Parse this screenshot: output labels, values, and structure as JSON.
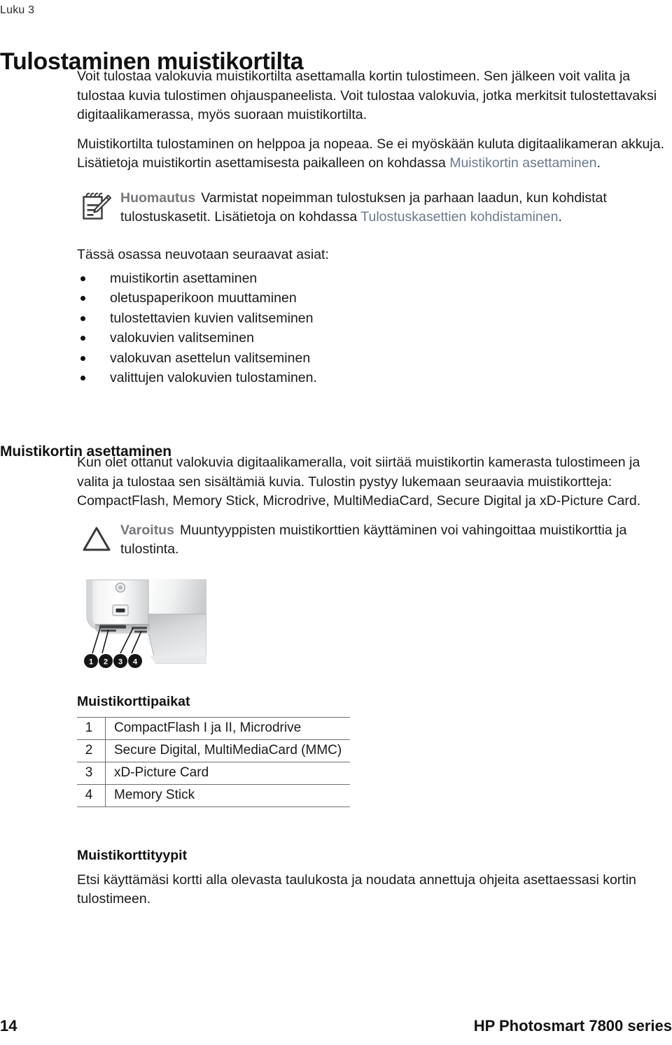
{
  "header": {
    "running_head": "Luku 3"
  },
  "chapter": {
    "title": "Tulostaminen muistikortilta"
  },
  "intro": {
    "para1": "Voit tulostaa valokuvia muistikortilta asettamalla kortin tulostimeen. Sen jälkeen voit valita ja tulostaa kuvia tulostimen ohjauspaneelista. Voit tulostaa valokuvia, jotka merkitsit tulostettavaksi digitaalikamerassa, myös suoraan muistikortilta.",
    "para2_before_link": "Muistikortilta tulostaminen on helppoa ja nopeaa. Se ei myöskään kuluta digitaalikameran akkuja. Lisätietoja muistikortin asettamisesta paikalleen on kohdassa ",
    "para2_link": "Muistikortin asettaminen",
    "para2_after_link": "."
  },
  "note": {
    "icon": "note-pencil-icon",
    "label": "Huomautus",
    "text_before_link": "Varmistat nopeimman tulostuksen ja parhaan laadun, kun kohdistat tulostuskasetit. Lisätietoja on kohdassa ",
    "link": "Tulostuskasettien kohdistaminen",
    "text_after_link": "."
  },
  "toc": {
    "lead": "Tässä osassa neuvotaan seuraavat asiat:",
    "items": [
      "muistikortin asettaminen",
      "oletuspaperikoon muuttaminen",
      "tulostettavien kuvien valitseminen",
      "valokuvien valitseminen",
      "valokuvan asettelun valitseminen",
      "valittujen valokuvien tulostaminen."
    ]
  },
  "section_insert": {
    "heading": "Muistikortin asettaminen",
    "para": "Kun olet ottanut valokuvia digitaalikameralla, voit siirtää muistikortin kamerasta tulostimeen ja valita ja tulostaa sen sisältämiä kuvia. Tulostin pystyy lukemaan seuraavia muistikortteja: CompactFlash, Memory Stick, Microdrive, MultiMediaCard, Secure Digital ja xD-Picture Card."
  },
  "caution": {
    "icon": "warning-triangle-icon",
    "label": "Varoitus",
    "text": "Muuntyyppisten muistikorttien käyttäminen voi vahingoittaa muistikorttia ja tulostinta."
  },
  "figure": {
    "alt_name": "printer-memory-card-slots-illustration",
    "callouts": [
      "1",
      "2",
      "3",
      "4"
    ]
  },
  "slots_table": {
    "caption": "Muistikorttipaikat",
    "rows": [
      {
        "num": "1",
        "desc": "CompactFlash I ja II, Microdrive"
      },
      {
        "num": "2",
        "desc": "Secure Digital, MultiMediaCard (MMC)"
      },
      {
        "num": "3",
        "desc": "xD-Picture Card"
      },
      {
        "num": "4",
        "desc": "Memory Stick"
      }
    ]
  },
  "card_types": {
    "heading": "Muistikorttityypit",
    "para": "Etsi käyttämäsi kortti alla olevasta taulukosta ja noudata annettuja ohjeita asettaessasi kortin tulostimeen."
  },
  "footer": {
    "page_number": "14",
    "product": "HP Photosmart 7800 series"
  },
  "colors": {
    "link": "#6b7a8d",
    "admon_label": "#77787b",
    "text": "#1a1a1a",
    "rule": "#6f6f6f"
  }
}
